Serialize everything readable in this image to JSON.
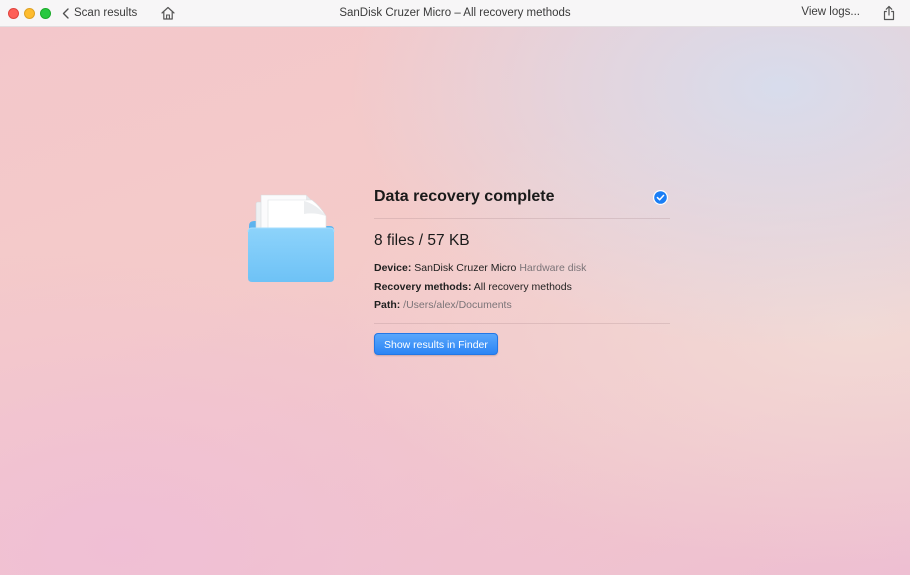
{
  "window": {
    "title": "SanDisk Cruzer Micro – All recovery methods"
  },
  "toolbar": {
    "back_label": "Scan results",
    "view_logs_label": "View logs..."
  },
  "result": {
    "title": "Data recovery complete",
    "summary": "8 files / 57 KB",
    "device_label": "Device:",
    "device_value": "SanDisk Cruzer Micro",
    "device_type": "Hardware disk",
    "methods_label": "Recovery methods:",
    "methods_value": "All recovery methods",
    "path_label": "Path:",
    "path_value": "/Users/alex/Documents",
    "finder_button_label": "Show results in Finder"
  },
  "colors": {
    "accent": "#2b85f5",
    "check": "#1a7ef5",
    "folder": "#7cc8f8"
  },
  "icons": {
    "back": "chevron-left-icon",
    "home": "home-icon",
    "share": "share-icon",
    "folder": "folder-icon",
    "check": "checkmark-circle-icon"
  }
}
